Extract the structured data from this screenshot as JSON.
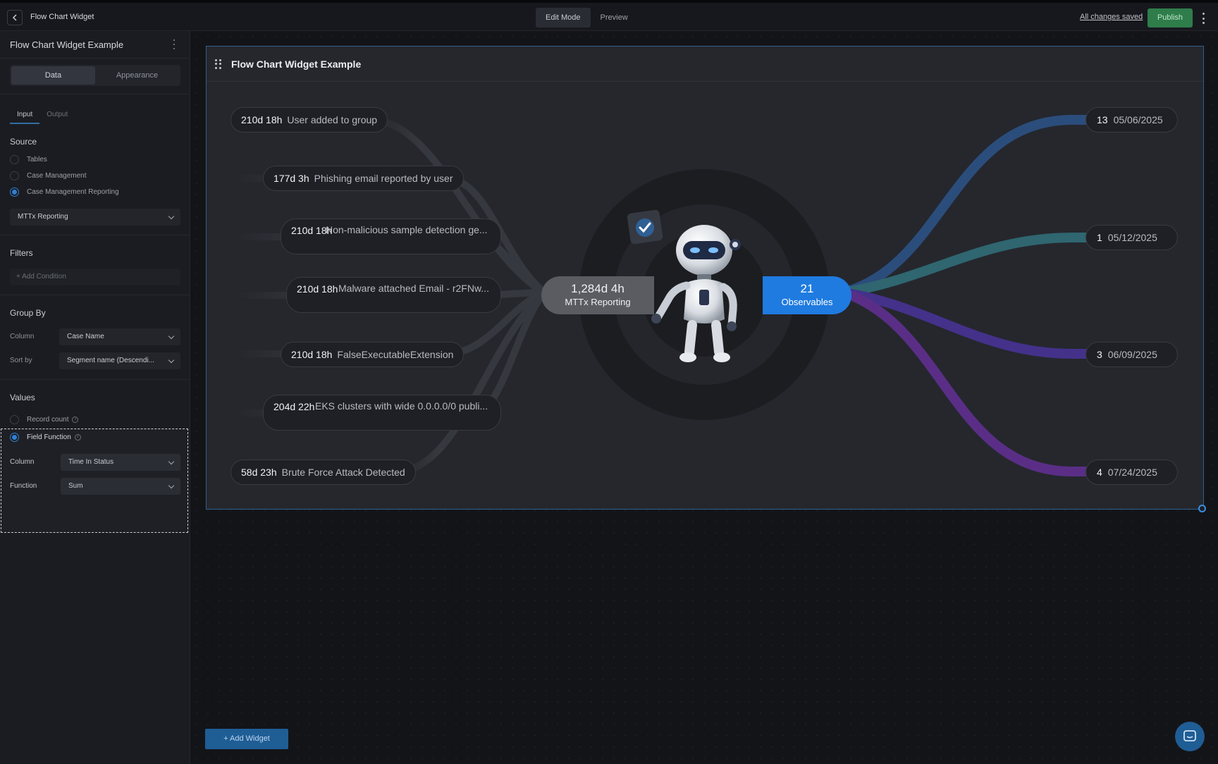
{
  "topbar": {
    "title": "Flow Chart Widget",
    "modes": [
      "Edit Mode",
      "Preview"
    ],
    "saved_status": "All changes saved",
    "publish_label": "Publish"
  },
  "sidebar": {
    "header": "Flow Chart Widget Example",
    "tabs": [
      "Data",
      "Appearance"
    ],
    "subtabs": [
      "Input",
      "Output"
    ],
    "source": {
      "title": "Source",
      "options": [
        "Tables",
        "Case Management",
        "Case Management Reporting"
      ],
      "selected_index": 2,
      "report_select": "MTTx Reporting"
    },
    "filters": {
      "title": "Filters",
      "add_condition": "+ Add Condition"
    },
    "group_by": {
      "title": "Group By",
      "column_label": "Column",
      "column_value": "Case Name",
      "sort_label": "Sort by",
      "sort_value": "Segment name (Descendi..."
    },
    "values": {
      "title": "Values",
      "record_count": "Record count",
      "field_function": "Field Function",
      "column_label": "Column",
      "column_value": "Time In Status",
      "function_label": "Function",
      "function_value": "Sum"
    }
  },
  "widget": {
    "title": "Flow Chart Widget Example",
    "left_items": [
      {
        "value": "210d 18h",
        "label": "User added to group"
      },
      {
        "value": "177d 3h",
        "label": "Phishing email reported by user"
      },
      {
        "value": "210d 18h",
        "label": "Non-malicious sample detection ge..."
      },
      {
        "value": "210d 18h",
        "label": "Malware attached Email - r2FNw..."
      },
      {
        "value": "210d 18h",
        "label": "FalseExecutableExtension"
      },
      {
        "value": "204d 22h",
        "label": "EKS clusters with wide 0.0.0.0/0 publi..."
      },
      {
        "value": "58d 23h",
        "label": "Brute Force Attack Detected"
      }
    ],
    "center_left": {
      "value": "1,284d 4h",
      "label": "MTTx Reporting"
    },
    "center_right": {
      "value": "21",
      "label": "Observables"
    },
    "right_items": [
      {
        "count": "13",
        "date": "05/06/2025",
        "color": "#2b4d7c"
      },
      {
        "count": "1",
        "date": "05/12/2025",
        "color": "#2f6670"
      },
      {
        "count": "3",
        "date": "06/09/2025",
        "color": "#44318a"
      },
      {
        "count": "4",
        "date": "07/24/2025",
        "color": "#5a2e86"
      }
    ]
  },
  "footer": {
    "add_widget": "+ Add Widget"
  }
}
